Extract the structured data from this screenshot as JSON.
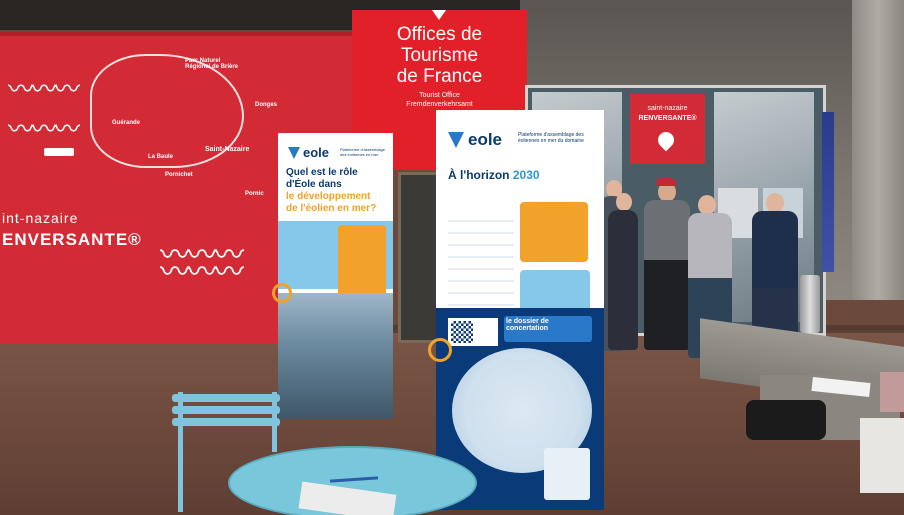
{
  "colors": {
    "wall_red": "#d22b35",
    "tourism_red": "#e1202a",
    "eole_navy": "#0b3a78",
    "eole_orange": "#f2a22a",
    "eole_lightblue": "#86c8ea",
    "table_blue": "#78c7da"
  },
  "wall": {
    "brand_line1": "int-nazaire",
    "brand_line2": "ENVERSANTE®",
    "map_labels": [
      "Guérande",
      "La Baule",
      "Pornichet",
      "Saint-Nazaire",
      "Pornic",
      "Parc Naturel Régional de Brière",
      "Donges"
    ]
  },
  "tourism_office": {
    "line1": "Offices de",
    "line2": "Tourisme",
    "line3": "de France",
    "sub1": "Tourist Office",
    "sub2": "Fremdenverkehrsamt"
  },
  "shop_sign": {
    "line1": "saint-nazaire",
    "line2": "RENVERSANTE®",
    "icon": "map-pin-icon"
  },
  "rollup_left": {
    "logo": "eole",
    "logo_icon": "eole-shield-icon",
    "tagline": "Plateforme d'assemblage des éoliennes en mer",
    "title_line1": "Quel est le rôle",
    "title_line2": "d'Éole dans",
    "title_line3": "le développement",
    "title_line4": "de l'éolien en mer?"
  },
  "rollup_right": {
    "logo": "eole",
    "logo_icon": "eole-shield-icon",
    "tagline": "Plateforme d'assemblage des éoliennes en mer du domaine",
    "title": "À l'horizon",
    "year": "2030",
    "badge": "le dossier de concertation"
  }
}
